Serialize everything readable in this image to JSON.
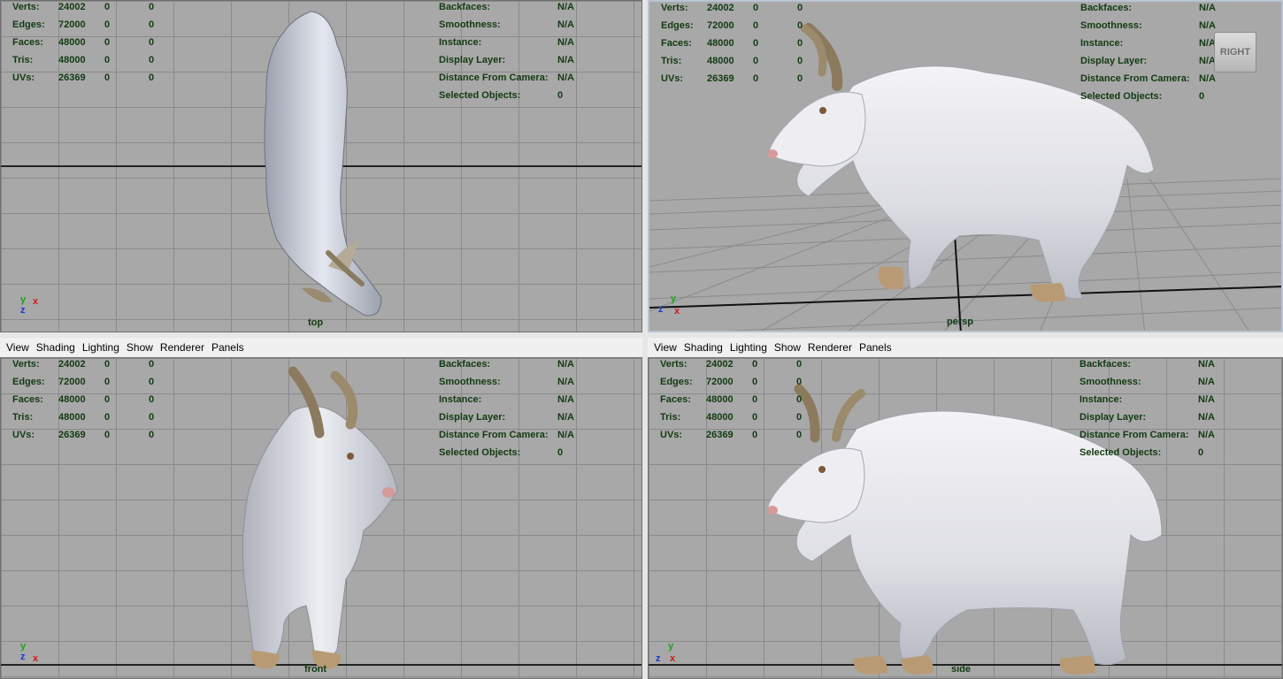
{
  "menu": [
    "View",
    "Shading",
    "Lighting",
    "Show",
    "Renderer",
    "Panels"
  ],
  "hud_left": [
    {
      "label": "Verts:",
      "value": "24002",
      "a": "0",
      "b": "0"
    },
    {
      "label": "Edges:",
      "value": "72000",
      "a": "0",
      "b": "0"
    },
    {
      "label": "Faces:",
      "value": "48000",
      "a": "0",
      "b": "0"
    },
    {
      "label": "Tris:",
      "value": "48000",
      "a": "0",
      "b": "0"
    },
    {
      "label": "UVs:",
      "value": "26369",
      "a": "0",
      "b": "0"
    }
  ],
  "hud_right": [
    {
      "label": "Backfaces:",
      "value": "N/A"
    },
    {
      "label": "Smoothness:",
      "value": "N/A"
    },
    {
      "label": "Instance:",
      "value": "N/A"
    },
    {
      "label": "Display Layer:",
      "value": "N/A"
    },
    {
      "label": "Distance From Camera:",
      "value": "N/A"
    },
    {
      "label": "Selected Objects:",
      "value": "0"
    }
  ],
  "viewports": {
    "top": {
      "camera": "top",
      "axis": [
        "y",
        "x",
        "z"
      ]
    },
    "persp": {
      "camera": "persp",
      "axis": [
        "y",
        "x",
        "z"
      ],
      "view_cube": "RIGHT"
    },
    "front": {
      "camera": "front",
      "axis": [
        "y",
        "x",
        "z"
      ]
    },
    "side": {
      "camera": "side",
      "axis": [
        "y",
        "x",
        "z"
      ]
    }
  },
  "colors": {
    "hud_text": "#123a12",
    "viewport_bg": "#a8a8a8",
    "grid": "#8a8a8a",
    "axis_x": "#d01a1a",
    "axis_y": "#1fa21f",
    "axis_z": "#1a3ad0"
  }
}
